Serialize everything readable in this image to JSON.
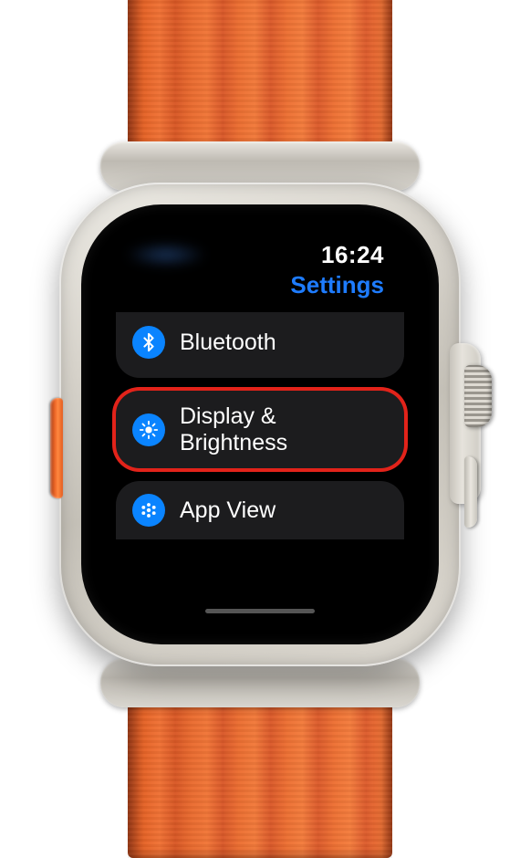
{
  "status": {
    "time": "16:24"
  },
  "title": "Settings",
  "rows": [
    {
      "label": "Bluetooth",
      "icon": "bluetooth-icon"
    },
    {
      "label": "Display & Brightness",
      "icon": "brightness-icon",
      "highlighted": true
    },
    {
      "label": "App View",
      "icon": "app-view-icon"
    }
  ],
  "colors": {
    "accent": "#1e7cff",
    "icon_bg": "#0a84ff",
    "highlight_ring": "#e2231a",
    "row_bg": "#1c1c1e",
    "band": "#ec6a2d"
  }
}
